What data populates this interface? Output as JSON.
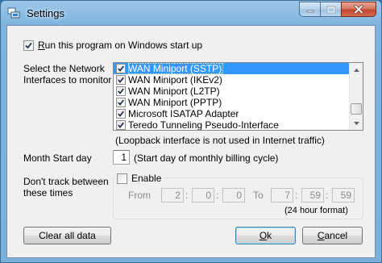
{
  "window": {
    "title": "Settings"
  },
  "startup": {
    "label_pre": "",
    "label_ul": "R",
    "label_post": "un this program on Windows start up",
    "checked": true
  },
  "network": {
    "label": "Select the Network Interfaces to monitor",
    "items": [
      {
        "label": "WAN Miniport (SSTP)",
        "checked": true,
        "selected": true
      },
      {
        "label": "WAN Miniport (IKEv2)",
        "checked": true,
        "selected": false
      },
      {
        "label": "WAN Miniport (L2TP)",
        "checked": true,
        "selected": false
      },
      {
        "label": "WAN Miniport (PPTP)",
        "checked": true,
        "selected": false
      },
      {
        "label": "Microsoft ISATAP Adapter",
        "checked": true,
        "selected": false
      },
      {
        "label": "Teredo Tunneling Pseudo-Interface",
        "checked": true,
        "selected": false
      }
    ],
    "note": "(Loopback interface is not used in Internet traffic)"
  },
  "month_start": {
    "label": "Month Start day",
    "value": "1",
    "hint": "(Start day of monthly billing cycle)"
  },
  "dont_track": {
    "label": "Don't track between these times",
    "enable_label": "Enable",
    "enabled": false,
    "from_label": "From",
    "from": [
      "2",
      "0",
      "0"
    ],
    "to_label": "To",
    "to": [
      "7",
      "59",
      "59"
    ],
    "sep": ":",
    "format_note": "(24 hour format)"
  },
  "buttons": {
    "clear": "Clear all data",
    "ok_ul": "O",
    "ok_rest": "k",
    "cancel_ul": "C",
    "cancel_rest": "ancel"
  },
  "colors": {
    "selection": "#3399ff",
    "titlebar": "#7fb3dd",
    "close_button": "#c4442c"
  }
}
